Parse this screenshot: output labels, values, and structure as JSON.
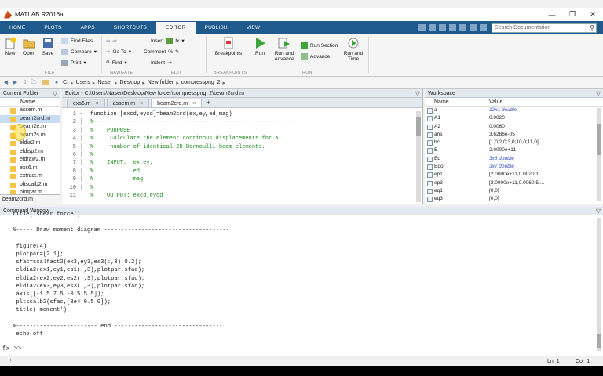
{
  "app": {
    "title": "MATLAB R2016a"
  },
  "tabs": [
    "HOME",
    "PLOTS",
    "APPS",
    "SHORTCUTS",
    "EDITOR",
    "PUBLISH",
    "VIEW"
  ],
  "active_tab": "EDITOR",
  "search": {
    "placeholder": "Search Documentation"
  },
  "ribbon": {
    "new": "New",
    "open": "Open",
    "save": "Save",
    "find_files": "Find Files",
    "compare": "Compare",
    "print": "Print",
    "goto": "Go To",
    "find": "Find",
    "insert": "Insert",
    "comment": "Comment",
    "indent": "Indent",
    "breakpoints": "Breakpoints",
    "run": "Run",
    "run_and_advance": "Run and\nAdvance",
    "run_section": "Run Section",
    "advance": "Advance",
    "run_and_time": "Run and\nTime",
    "groups": {
      "file": "FILE",
      "navigate": "NAVIGATE",
      "edit": "EDIT",
      "breakpoints": "BREAKPOINTS",
      "run": "RUN"
    }
  },
  "address": {
    "path": [
      "C:",
      "Users",
      "Naser",
      "Desktop",
      "New folder",
      "compresspng_2"
    ]
  },
  "current_folder": {
    "title": "Current Folder",
    "col_name": "Name",
    "files": [
      "assem.m",
      "beam2crd.m",
      "beam2e.m",
      "beam2s.m",
      "eldia2.m",
      "eldisp2.m",
      "eldraw2.m",
      "exs6.m",
      "extract.m",
      "pltscalb2.m",
      "plotpar.m"
    ],
    "selected": "beam2crd.m",
    "footer": "beam2crd.m"
  },
  "editor": {
    "title": "Editor - C:\\Users\\Naser\\Desktop\\New folder\\compresspng_2\\beam2crd.m",
    "tabs": [
      "exs6.m",
      "assem.m",
      "beam2crd.m"
    ],
    "active_tab": "beam2crd.m",
    "line_numbers": [
      "1",
      "2",
      "3",
      "4",
      "5",
      "6",
      "7",
      "8",
      "9",
      "10",
      "11"
    ],
    "lines": [
      "function [excd,eycd]=beam2crd(ex,ey,ed,mag)",
      "%-------------------------------------------------------------",
      "%    PURPOSE",
      "%     Calculate the element continous displacements for a",
      "%     number of identical 2D Bernoulli beam elements.",
      "%",
      "%    INPUT:  ex,ey,",
      "%            ed,",
      "%            mag",
      "%",
      "%    OUTPUT: excd,eycd"
    ]
  },
  "workspace": {
    "title": "Workspace",
    "col_name": "Name",
    "col_value": "Value",
    "rows": [
      {
        "name": "a",
        "value": "12x1 double",
        "italic": true
      },
      {
        "name": "A1",
        "value": "0.0020",
        "italic": false
      },
      {
        "name": "A2",
        "value": "0.0060",
        "italic": false
      },
      {
        "name": "ans",
        "value": "3.6286e-05",
        "italic": false
      },
      {
        "name": "bc",
        "value": "[1,0;2,0;3,0;10,0;11,0]",
        "italic": false
      },
      {
        "name": "E",
        "value": "2.0000e+11",
        "italic": false
      },
      {
        "name": "Ed",
        "value": "3x6 double",
        "italic": true
      },
      {
        "name": "Edof",
        "value": "3x7 double",
        "italic": true
      },
      {
        "name": "ep1",
        "value": "[2.0000e+11,0.0020,1....",
        "italic": false
      },
      {
        "name": "ep3",
        "value": "[2.0000e+11,0.0060,5....",
        "italic": false
      },
      {
        "name": "eq1",
        "value": "[0,0]",
        "italic": false
      },
      {
        "name": "eq3",
        "value": "[0,0]",
        "italic": false
      }
    ]
  },
  "command_window": {
    "title": "Command Window",
    "lines": [
      "title('shear force')",
      "",
      "%----- Draw moment diagram -------------------------------------",
      "",
      " figure(4)",
      " plotpar=[2 1];",
      " sfac=scalfact2(ex3,ey3,es3(:,3),0.2);",
      " eldia2(ex1,ey1,es1(:,3),plotpar,sfac);",
      " eldia2(ex2,ey2,es2(:,3),plotpar,sfac);",
      " eldia2(ex3,ey3,es3(:,3),plotpar,sfac);",
      " axis([-1.5 7.5 -0.5 5.5]);",
      " pltscalb2(sfac,[3e4 0.5 0]);",
      " title('moment')",
      "",
      "%------------------------ end --------------------------------",
      " echo off"
    ],
    "prompt": "fx >>"
  },
  "status": {
    "ln_label": "Ln",
    "ln": "1",
    "col_label": "Col",
    "col": "1"
  }
}
